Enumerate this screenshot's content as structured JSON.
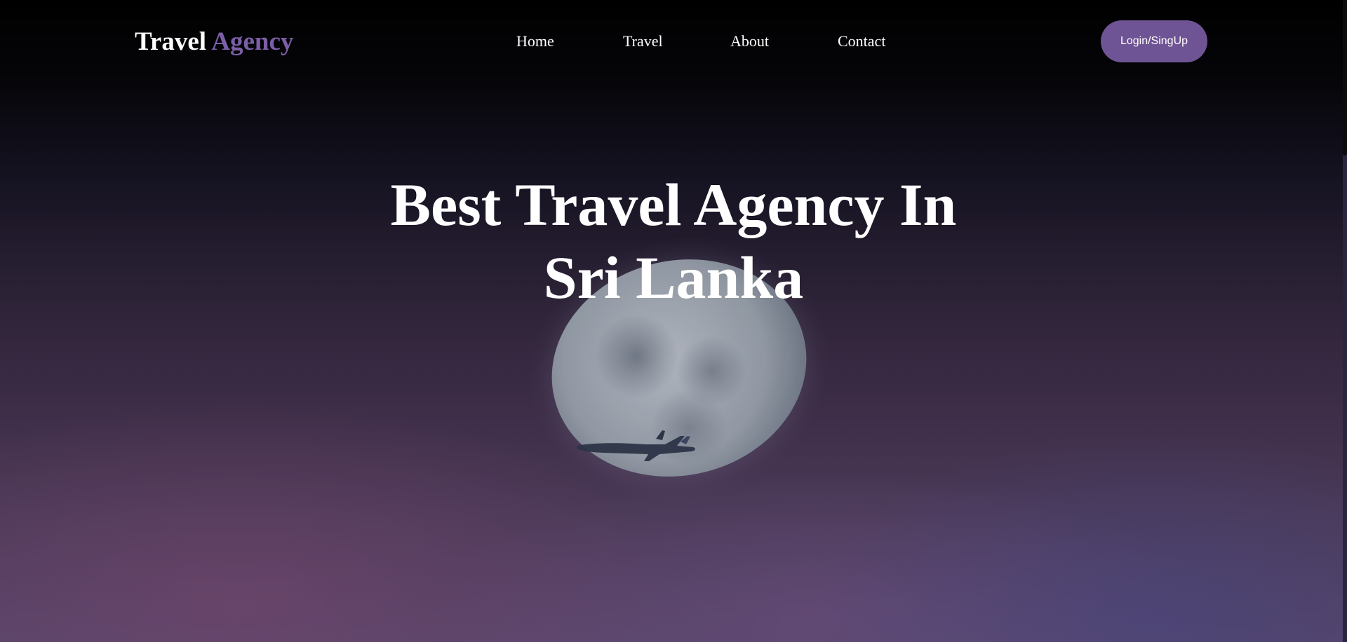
{
  "header": {
    "logo_part1": "Travel",
    "logo_part2": "Agency",
    "nav": [
      {
        "label": "Home"
      },
      {
        "label": "Travel"
      },
      {
        "label": "About"
      },
      {
        "label": "Contact"
      }
    ],
    "login_label": "Login/SingUp"
  },
  "hero": {
    "title_line1": "Best Travel Agency In",
    "title_line2": "Sri Lanka"
  },
  "colors": {
    "accent": "#6f5495",
    "logo_accent": "#7b5fa6",
    "text": "#ffffff",
    "background_top": "#000000",
    "background_bottom": "#564569"
  },
  "icons": {
    "background_image": "moon-airplane-night-sky"
  }
}
